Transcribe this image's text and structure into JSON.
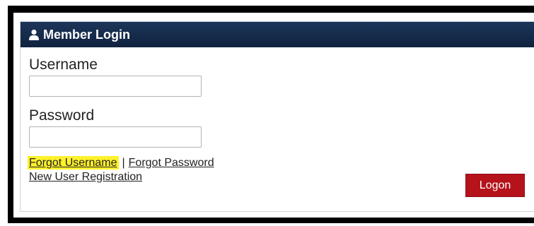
{
  "panel": {
    "title": "Member Login",
    "icon": "user-icon"
  },
  "form": {
    "username_label": "Username",
    "username_value": "",
    "password_label": "Password",
    "password_value": ""
  },
  "links": {
    "forgot_username": "Forgot Username",
    "separator": "|",
    "forgot_password": "Forgot Password",
    "new_user": "New User Registration"
  },
  "actions": {
    "logon": "Logon"
  },
  "colors": {
    "header_bg": "#162c4d",
    "button_bg": "#b5121b",
    "highlight": "#fff12a"
  }
}
